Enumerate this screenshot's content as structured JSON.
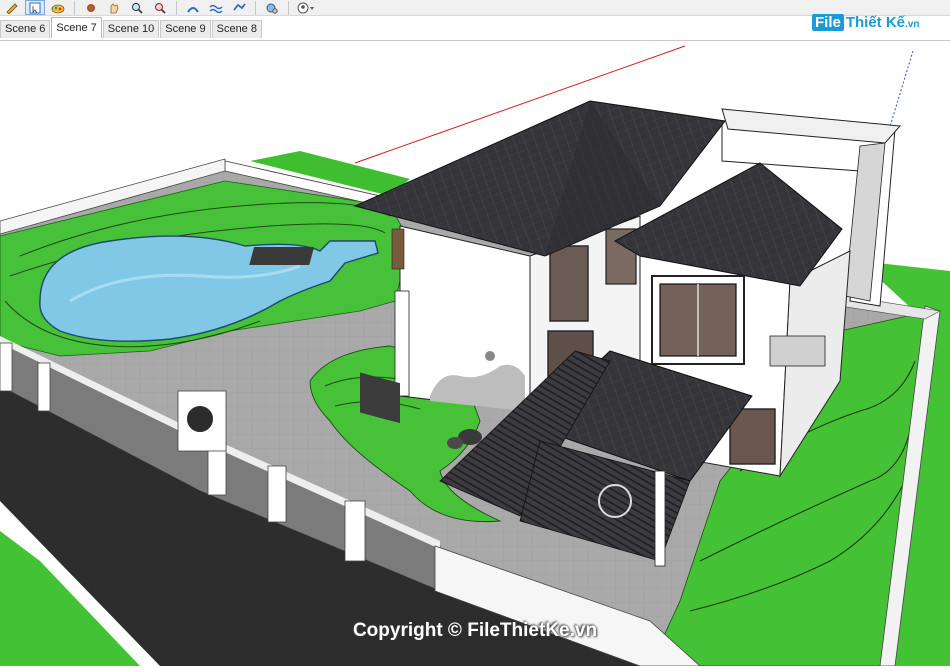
{
  "toolbar": {
    "icons": [
      "pencil-icon",
      "clipboard-icon",
      "paint-bucket-icon",
      "move-icon",
      "pan-icon",
      "zoom-icon",
      "zoom-extents-icon",
      "warehouse-icon",
      "sandbox-icon",
      "extension-icon",
      "settings-icon",
      "user-icon"
    ]
  },
  "scene_tabs": [
    "Scene 6",
    "Scene 7",
    "Scene 10",
    "Scene 9",
    "Scene 8"
  ],
  "active_scene": "Scene 7",
  "logo": {
    "file": "File",
    "rest": "Thiết Kế",
    "tld": ".vn"
  },
  "watermark": "Copyright © FileThietKe.vn",
  "colors": {
    "grass": "#3fbf2f",
    "water": "#7fc9e8",
    "roof": "#333338",
    "road": "#2b2b2b",
    "paving": "#a8a8a8",
    "wall": "#ffffff"
  }
}
